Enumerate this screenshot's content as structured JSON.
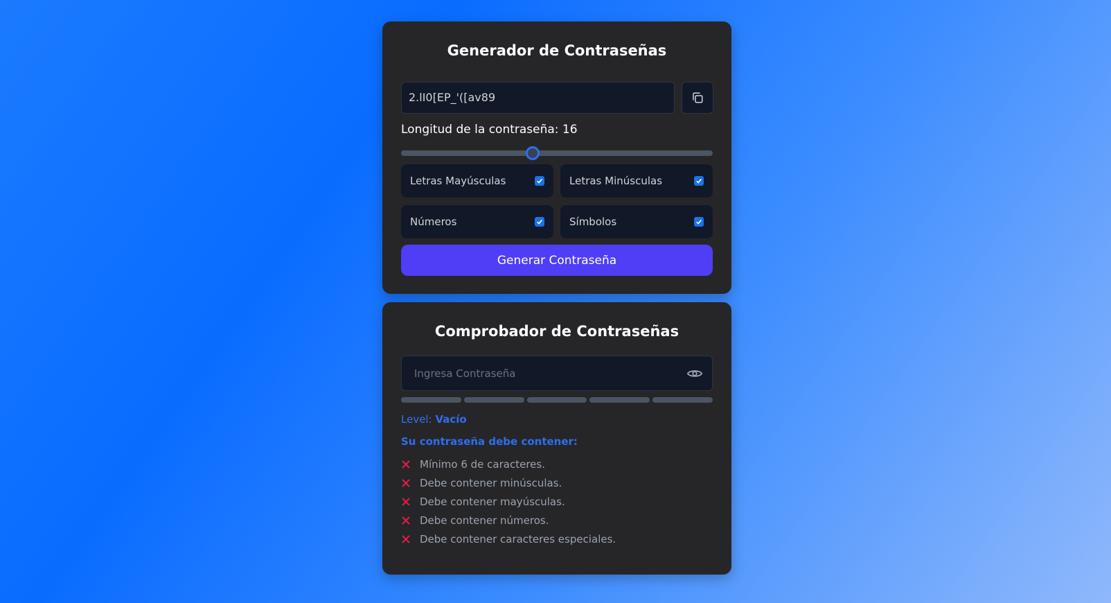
{
  "generator": {
    "title": "Generador de Contraseñas",
    "password": "2.lI0[EP_'([av89",
    "length_label": "Longitud de la contraseña: 16",
    "length_value": 16,
    "length_fraction": 0.42,
    "options": [
      {
        "label": "Letras Mayúsculas",
        "checked": true
      },
      {
        "label": "Letras Minúsculas",
        "checked": true
      },
      {
        "label": "Números",
        "checked": true
      },
      {
        "label": "Símbolos",
        "checked": true
      }
    ],
    "button_label": "Generar Contraseña"
  },
  "checker": {
    "title": "Comprobador de Contraseñas",
    "placeholder": "Ingresa Contraseña",
    "level_prefix": "Level:",
    "level_value": "Vacío",
    "requirements_title": "Su contraseña debe contener:",
    "requirements": [
      "Mínimo 6 de caracteres.",
      "Debe contener minúsculas.",
      "Debe contener mayúsculas.",
      "Debe contener números.",
      "Debe contener caracteres especiales."
    ]
  },
  "colors": {
    "accent": "#4f3ef5",
    "link_blue": "#2f6df0",
    "fail_red": "#e11d48",
    "card_bg": "#262628"
  },
  "icons": {
    "copy": "copy-icon",
    "eye": "eye-icon",
    "fail": "x-icon",
    "check": "check-icon"
  }
}
